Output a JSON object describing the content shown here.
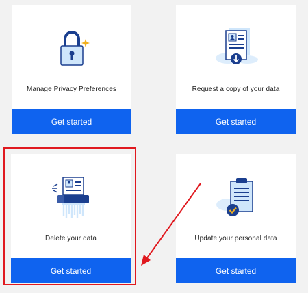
{
  "colors": {
    "page_bg": "#f2f2f2",
    "card_bg": "#ffffff",
    "button_bg": "#0f63ef",
    "button_text": "#ffffff",
    "highlight": "#e0191f",
    "illustration_primary": "#1b3f8f",
    "illustration_light": "#cfe6fb",
    "illustration_accent": "#f2b01e"
  },
  "cards": [
    {
      "id": "privacy",
      "title": "Manage Privacy Preferences",
      "button_label": "Get started",
      "icon": "padlock-icon"
    },
    {
      "id": "copy",
      "title": "Request a copy of your data",
      "button_label": "Get started",
      "icon": "document-download-icon"
    },
    {
      "id": "delete",
      "title": "Delete your data",
      "button_label": "Get started",
      "icon": "shredder-icon"
    },
    {
      "id": "update",
      "title": "Update your personal data",
      "button_label": "Get started",
      "icon": "clipboard-check-icon"
    }
  ],
  "annotation": {
    "highlighted_card": "delete",
    "arrow": "red-arrow-icon"
  }
}
